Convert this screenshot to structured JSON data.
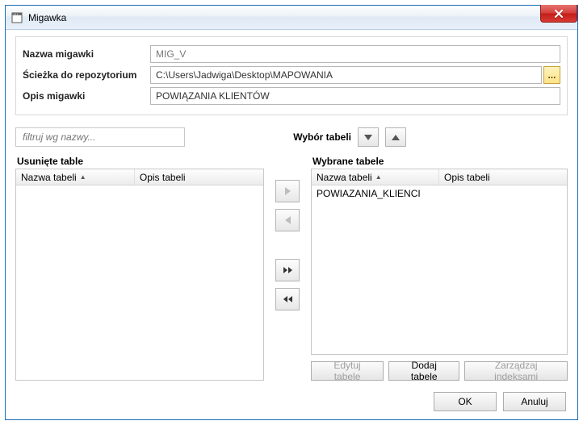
{
  "window": {
    "title": "Migawka"
  },
  "form": {
    "name_label": "Nazwa migawki",
    "name_value": "MIG_V",
    "repo_label": "Ścieżka do repozytorium",
    "repo_value": "C:\\Users\\Jadwiga\\Desktop\\MAPOWANIA",
    "desc_label": "Opis migawki",
    "desc_value": "POWIĄZANIA KLIENTÓW",
    "browse_label": "..."
  },
  "filter": {
    "placeholder": "filtruj wg nazwy..."
  },
  "selection": {
    "label": "Wybór tabeli"
  },
  "left_grid": {
    "caption": "Usunięte table",
    "col_name": "Nazwa tabeli",
    "col_desc": "Opis tabeli",
    "rows": []
  },
  "right_grid": {
    "caption": "Wybrane tabele",
    "col_name": "Nazwa tabeli",
    "col_desc": "Opis tabeli",
    "rows": [
      {
        "name": "POWIAZANIA_KLIENCI",
        "desc": ""
      }
    ]
  },
  "actions": {
    "edit": "Edytuj tabele",
    "add": "Dodaj tabele",
    "index": "Zarządzaj indeksami"
  },
  "dialog": {
    "ok": "OK",
    "cancel": "Anuluj"
  }
}
